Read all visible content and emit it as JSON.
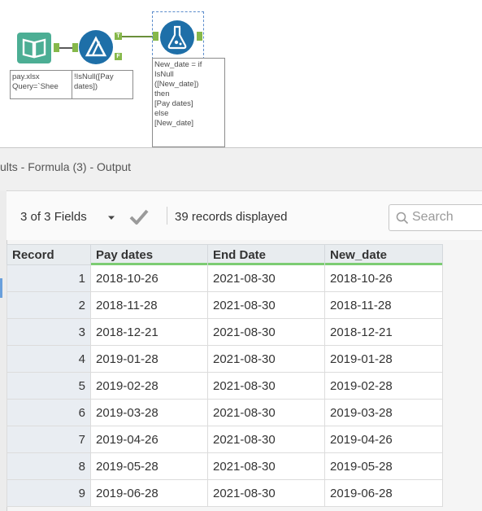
{
  "canvas": {
    "annotations": {
      "input": "pay.xlsx\nQuery=`Shee",
      "filter": "!IsNull([Pay\ndates])",
      "formula": "New_date = if\nIsNull\n([New_date])\nthen\n[Pay dates]\nelse\n[New_date]"
    },
    "anchor_labels": {
      "true": "T",
      "false": "F"
    }
  },
  "results": {
    "title": "ults - Formula (3) - Output",
    "fields_label": "3 of 3 Fields",
    "records_label": "39 records displayed",
    "search_placeholder": "Search"
  },
  "grid": {
    "columns": [
      "Record",
      "Pay dates",
      "End Date",
      "New_date"
    ],
    "rows": [
      [
        "1",
        "2018-10-26",
        "2021-08-30",
        "2018-10-26"
      ],
      [
        "2",
        "2018-11-28",
        "2021-08-30",
        "2018-11-28"
      ],
      [
        "3",
        "2018-12-21",
        "2021-08-30",
        "2018-12-21"
      ],
      [
        "4",
        "2019-01-28",
        "2021-08-30",
        "2019-01-28"
      ],
      [
        "5",
        "2019-02-28",
        "2021-08-30",
        "2019-02-28"
      ],
      [
        "6",
        "2019-03-28",
        "2021-08-30",
        "2019-03-28"
      ],
      [
        "7",
        "2019-04-26",
        "2021-08-30",
        "2019-04-26"
      ],
      [
        "8",
        "2019-05-28",
        "2021-08-30",
        "2019-05-28"
      ],
      [
        "9",
        "2019-06-28",
        "2021-08-30",
        "2019-06-28"
      ]
    ]
  },
  "colors": {
    "tool_blue": "#1e6fa8",
    "input_green": "#4cae94",
    "anchor_green": "#86b84a",
    "header_underline": "#7ccc73"
  },
  "icons": {
    "input_tool": "book-icon",
    "filter_tool": "filter-triangle-icon",
    "formula_tool": "flask-icon",
    "fields_dropdown": "chevron-down-icon",
    "apply": "checkmark-icon",
    "search": "magnifier-icon"
  }
}
